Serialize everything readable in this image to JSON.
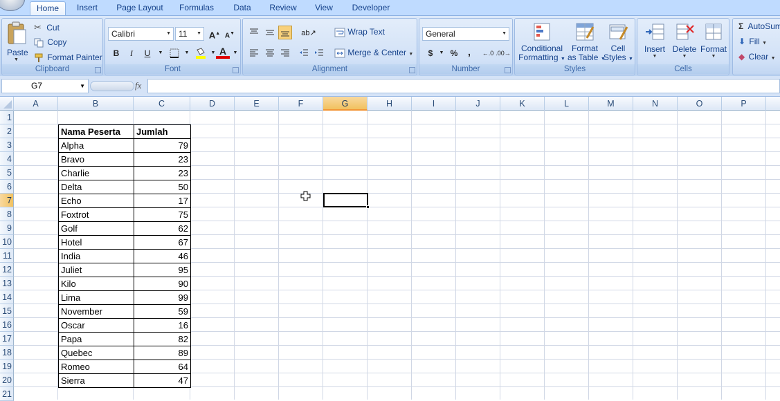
{
  "tabs": [
    "Home",
    "Insert",
    "Page Layout",
    "Formulas",
    "Data",
    "Review",
    "View",
    "Developer"
  ],
  "clipboard": {
    "paste": "Paste",
    "cut": "Cut",
    "copy": "Copy",
    "format_painter": "Format Painter",
    "label": "Clipboard"
  },
  "font": {
    "name": "Calibri",
    "size": "11",
    "label": "Font",
    "bold": "B",
    "italic": "I",
    "underline": "U",
    "color_letter": "A"
  },
  "alignment": {
    "wrap_text": "Wrap Text",
    "merge_center": "Merge & Center",
    "label": "Alignment"
  },
  "number": {
    "format": "General",
    "currency": "$",
    "percent": "%",
    "comma": ",",
    "label": "Number"
  },
  "styles": {
    "conditional": [
      "Conditional",
      "Formatting"
    ],
    "format_table": [
      "Format",
      "as Table"
    ],
    "cell_styles": [
      "Cell",
      "Styles"
    ],
    "label": "Styles"
  },
  "cells": {
    "insert": "Insert",
    "delete": "Delete",
    "format": "Format",
    "label": "Cells"
  },
  "editing": {
    "autosum": "AutoSum",
    "fill": "Fill",
    "clear": "Clear"
  },
  "formula_bar": {
    "name_box": "G7",
    "fx": "fx",
    "formula": ""
  },
  "columns": [
    "A",
    "B",
    "C",
    "D",
    "E",
    "F",
    "G",
    "H",
    "I",
    "J",
    "K",
    "L",
    "M",
    "N",
    "O",
    "P"
  ],
  "rows": [
    "1",
    "2",
    "3",
    "4",
    "5",
    "6",
    "7",
    "8",
    "9",
    "10",
    "11",
    "12",
    "13",
    "14",
    "15",
    "16",
    "17",
    "18",
    "19",
    "20",
    "21"
  ],
  "selected_cell": "G7",
  "table": {
    "headers": [
      "Nama Peserta",
      "Jumlah Poin"
    ],
    "rows": [
      [
        "Alpha",
        "79"
      ],
      [
        "Bravo",
        "23"
      ],
      [
        "Charlie",
        "23"
      ],
      [
        "Delta",
        "50"
      ],
      [
        "Echo",
        "17"
      ],
      [
        "Foxtrot",
        "75"
      ],
      [
        "Golf",
        "62"
      ],
      [
        "Hotel",
        "67"
      ],
      [
        "India",
        "46"
      ],
      [
        "Juliet",
        "95"
      ],
      [
        "Kilo",
        "90"
      ],
      [
        "Lima",
        "99"
      ],
      [
        "November",
        "59"
      ],
      [
        "Oscar",
        "16"
      ],
      [
        "Papa",
        "82"
      ],
      [
        "Quebec",
        "89"
      ],
      [
        "Romeo",
        "64"
      ],
      [
        "Sierra",
        "47"
      ]
    ]
  },
  "colors": {
    "selected_header": "#f1c15f",
    "ribbon": "#c7dbf5",
    "grid_line": "#d0d7e5"
  }
}
